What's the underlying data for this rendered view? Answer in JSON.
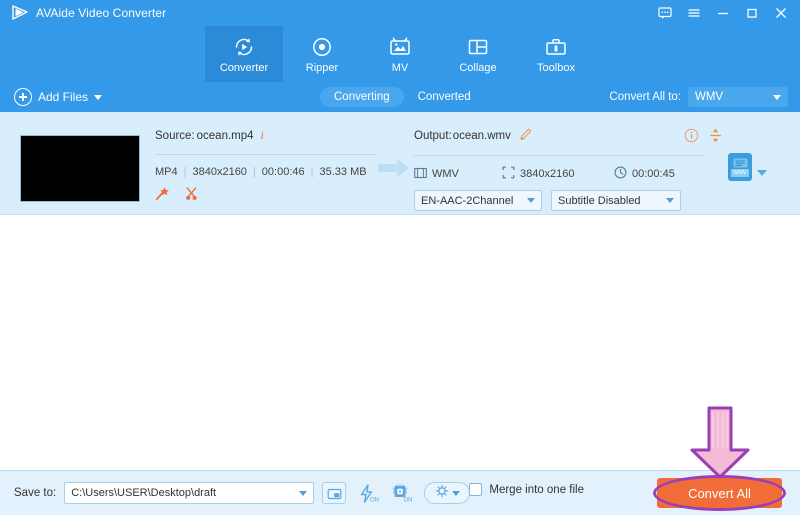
{
  "window": {
    "app_title": "AVAide Video Converter",
    "logo_icon": "play-triangle-logo",
    "controls": [
      {
        "name": "feedback-icon",
        "glyph": "speech-bubble"
      },
      {
        "name": "menu-icon",
        "glyph": "hamburger"
      },
      {
        "name": "minimize-icon",
        "glyph": "dash"
      },
      {
        "name": "maximize-icon",
        "glyph": "square"
      },
      {
        "name": "close-icon",
        "glyph": "cross"
      }
    ]
  },
  "nav": {
    "tabs": [
      {
        "label": "Converter",
        "icon": "convert-circular-arrows-icon",
        "active": true
      },
      {
        "label": "Ripper",
        "icon": "disc-icon",
        "active": false
      },
      {
        "label": "MV",
        "icon": "tv-photo-icon",
        "active": false
      },
      {
        "label": "Collage",
        "icon": "collage-grid-icon",
        "active": false
      },
      {
        "label": "Toolbox",
        "icon": "toolbox-icon",
        "active": false
      }
    ]
  },
  "toolbar": {
    "add_files_label": "Add Files",
    "add_files_icon": "plus-circle-icon",
    "add_files_caret": "chevron-down-icon",
    "segments": [
      {
        "label": "Converting",
        "active": true
      },
      {
        "label": "Converted",
        "active": false
      }
    ],
    "convert_all_to_label": "Convert All to:",
    "convert_all_to_value": "WMV"
  },
  "file_item": {
    "thumbnail": "video-thumbnail-black",
    "source": {
      "prefix": "Source: ",
      "filename": "ocean.mp4",
      "info_icon": "info-italic-i-icon",
      "format": "MP4",
      "resolution": "3840x2160",
      "duration": "00:00:46",
      "filesize": "35.33 MB",
      "tools": [
        {
          "name": "magic-wand-edit-icon",
          "label": "Edit"
        },
        {
          "name": "scissors-trim-icon",
          "label": "Trim"
        }
      ]
    },
    "arrow_icon": "arrow-right-icon",
    "output": {
      "prefix": "Output: ",
      "filename": "ocean.wmv",
      "rename_icon": "pencil-edit-icon",
      "info_icon": "info-circle-icon",
      "merge_icon": "vertical-resize-icon",
      "format": "WMV",
      "format_icon": "film-strip-icon",
      "resolution": "3840x2160",
      "resolution_icon": "expand-arrows-icon",
      "duration": "00:00:45",
      "duration_icon": "clock-icon",
      "audio_track": "EN-AAC-2Channel",
      "subtitle_track": "Subtitle Disabled"
    },
    "preset_badge": "WMV",
    "preset_caret": "chevron-down-icon"
  },
  "bottom": {
    "save_to_label": "Save to:",
    "save_to_path": "C:\\Users\\USER\\Desktop\\draft",
    "path_caret": "chevron-down-icon",
    "buttons": [
      {
        "name": "open-folder-icon",
        "label": "Open folder"
      },
      {
        "name": "hardware-accel-bolt-icon",
        "label": "ON"
      },
      {
        "name": "gpu-chip-icon",
        "label": "ON"
      },
      {
        "name": "settings-gear-icon",
        "label": "Settings"
      }
    ],
    "merge_checkbox_label": "Merge into one file",
    "merge_checked": false,
    "convert_all_button": "Convert All"
  },
  "annotation": {
    "arrow_icon": "down-arrow-highlight",
    "arrow_fill": "#f2b8cf",
    "arrow_stroke": "#9a3fb8",
    "ellipse_stroke": "#9a3fb8",
    "target": "Convert All"
  },
  "colors": {
    "brand_blue": "#3399e8",
    "nav_active": "#2c8bd8",
    "file_row_bg": "#d9eefc",
    "bottom_bg": "#e3f1fc",
    "accent_orange": "#f26c38",
    "highlight_purple": "#9a3fb8"
  }
}
